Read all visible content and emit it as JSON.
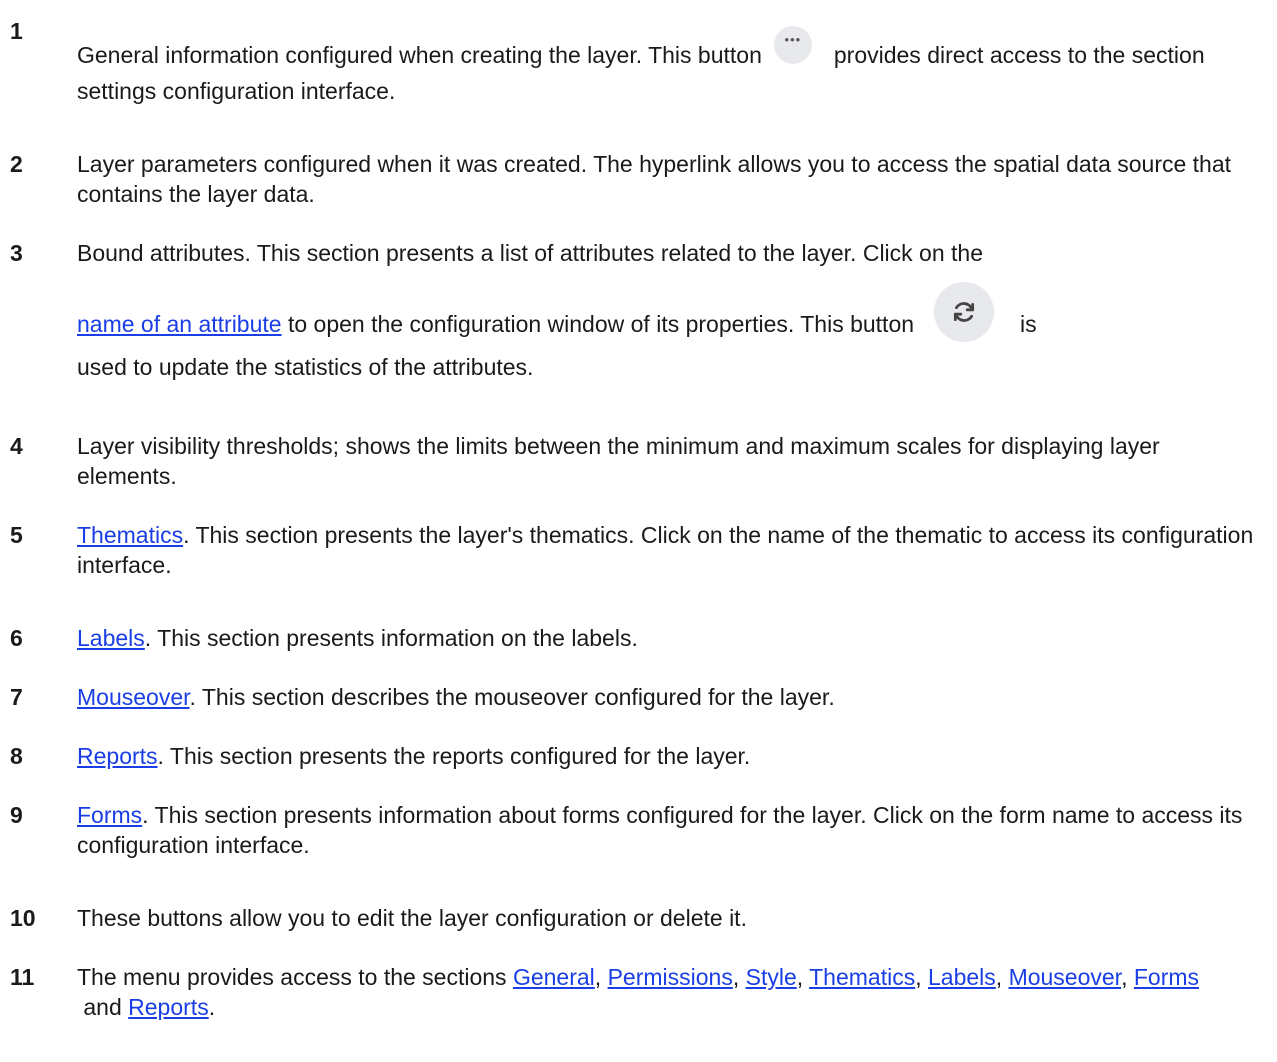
{
  "items": [
    {
      "num": "1",
      "parts": [
        "General information configured when creating the layer. This button",
        "provides direct access to the section settings configuration interface."
      ],
      "icon": "ellipsis-icon"
    },
    {
      "num": "2",
      "text": "Layer parameters configured when it was created. The hyperlink allows you to access the spatial data source that contains the layer data."
    },
    {
      "num": "3",
      "line1": "Bound attributes. This section presents a list of attributes related to the layer. Click on the",
      "link": "name of an attribute",
      "after_link": "to open the configuration window of its properties. This button",
      "after_icon": "is",
      "line3": "used to update the statistics of the attributes.",
      "icon": "refresh-icon"
    },
    {
      "num": "4",
      "text": "Layer visibility thresholds; shows the limits between the minimum and maximum scales for displaying layer elements."
    },
    {
      "num": "5",
      "link": "Thematics",
      "text": ". This section presents the layer's thematics. Click on the name of the thematic to access its configuration interface."
    },
    {
      "num": "6",
      "link": "Labels",
      "text": ". This section presents information on the labels."
    },
    {
      "num": "7",
      "link": "Mouseover",
      "text": ". This section describes the mouseover configured for the layer."
    },
    {
      "num": "8",
      "link": "Reports",
      "text": ". This section presents the reports configured for the layer."
    },
    {
      "num": "9",
      "link": "Forms",
      "text": ". This section presents information about forms configured for the layer. Click on the form name to access its configuration interface."
    },
    {
      "num": "10",
      "text": "These buttons allow you to edit the layer configuration or delete it."
    },
    {
      "num": "11",
      "intro": "The menu provides access to the sections",
      "links": [
        "General",
        "Permissions",
        "Style",
        "Thematics",
        "Labels",
        "Mouseover",
        "Forms",
        "Reports"
      ],
      "sep": ", ",
      "and": " and ",
      "end": "."
    }
  ]
}
